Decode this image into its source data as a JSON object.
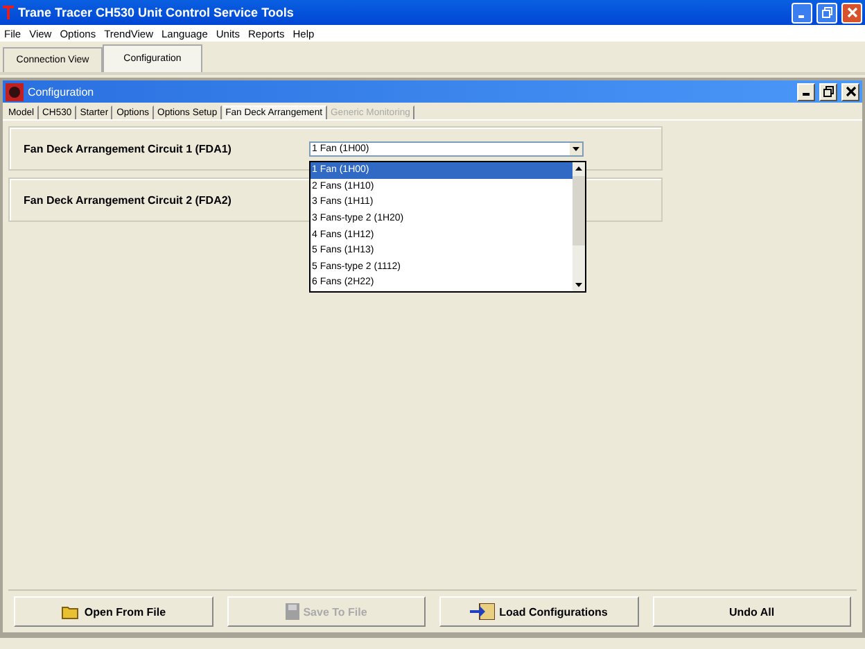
{
  "window": {
    "title": "Trane Tracer CH530 Unit Control Service Tools"
  },
  "menu": [
    "File",
    "View",
    "Options",
    "TrendView",
    "Language",
    "Units",
    "Reports",
    "Help"
  ],
  "view_tabs": [
    {
      "label": "Connection View",
      "selected": false
    },
    {
      "label": "Configuration",
      "selected": true
    }
  ],
  "child_window": {
    "title": "Configuration"
  },
  "tabs": [
    {
      "label": "Model",
      "selected": false,
      "disabled": false
    },
    {
      "label": "CH530",
      "selected": false,
      "disabled": false
    },
    {
      "label": "Starter",
      "selected": false,
      "disabled": false
    },
    {
      "label": "Options",
      "selected": false,
      "disabled": false
    },
    {
      "label": "Options Setup",
      "selected": false,
      "disabled": false
    },
    {
      "label": "Fan Deck Arrangement",
      "selected": true,
      "disabled": false
    },
    {
      "label": "Generic Monitoring",
      "selected": false,
      "disabled": true
    }
  ],
  "settings": [
    {
      "label": "Fan Deck Arrangement Circuit 1 (FDA1)",
      "value": "1 Fan (1H00)",
      "expanded": true,
      "options": [
        {
          "label": "1 Fan (1H00)",
          "selected": true
        },
        {
          "label": "2 Fans (1H10)",
          "selected": false
        },
        {
          "label": "3 Fans (1H11)",
          "selected": false
        },
        {
          "label": "3 Fans-type 2 (1H20)",
          "selected": false
        },
        {
          "label": "4 Fans (1H12)",
          "selected": false
        },
        {
          "label": "5 Fans (1H13)",
          "selected": false
        },
        {
          "label": "5 Fans-type 2 (1112)",
          "selected": false
        },
        {
          "label": "6 Fans (2H22)",
          "selected": false
        }
      ]
    },
    {
      "label": "Fan Deck Arrangement Circuit 2 (FDA2)"
    }
  ],
  "buttons": [
    {
      "label": "Open From File",
      "kind": "folder",
      "disabled": false
    },
    {
      "label": "Save To File",
      "kind": "disk",
      "disabled": true
    },
    {
      "label": "Load Configurations",
      "kind": "load",
      "disabled": false
    },
    {
      "label": "Undo All",
      "kind": "plain",
      "disabled": false
    }
  ]
}
